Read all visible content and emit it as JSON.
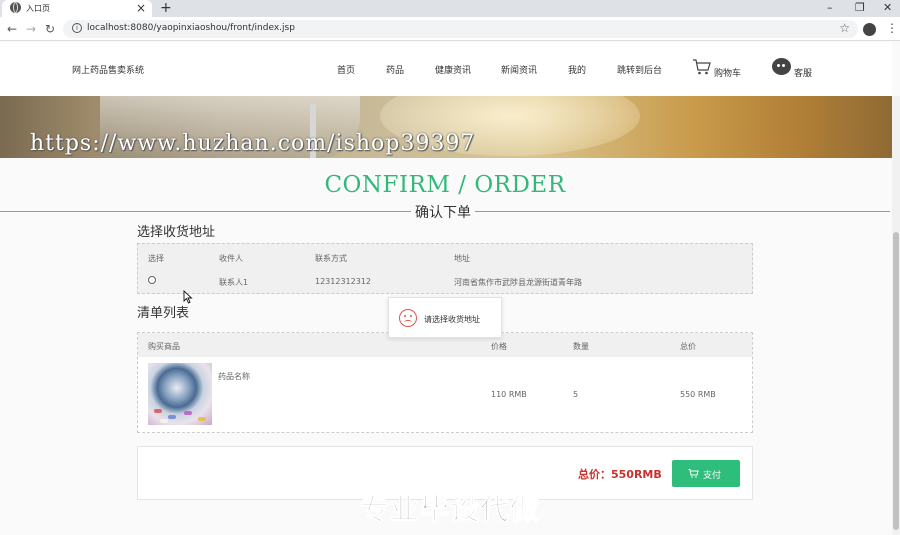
{
  "browser": {
    "tab_title": "入口页",
    "url": "localhost:8080/yaopinxiaoshou/front/index.jsp",
    "newtab_label": "+",
    "tab_close": "×",
    "minimize": "–",
    "restore": "❐",
    "close": "✕",
    "back": "←",
    "forward": "→",
    "reload": "↻",
    "star": "☆",
    "menu": "⋮",
    "info": "i"
  },
  "site": {
    "logo": "网上药品售卖系统",
    "nav": [
      "首页",
      "药品",
      "健康资讯",
      "新闻资讯",
      "我的",
      "跳转到后台"
    ],
    "cart": "购物车",
    "service": "客服"
  },
  "banner": {
    "watermark": "https://www.huzhan.com/ishop39397"
  },
  "page": {
    "title_en": "CONFIRM / ORDER",
    "title_cn": "确认下单",
    "address_section": "选择收货地址",
    "list_section": "清单列表"
  },
  "address_table": {
    "headers": [
      "选择",
      "收件人",
      "联系方式",
      "地址"
    ],
    "rows": [
      {
        "name": "联系人1",
        "phone": "12312312312",
        "address": "河南省焦作市武陟县龙源街道青年路"
      }
    ]
  },
  "list_table": {
    "headers": [
      "购买商品",
      "价格",
      "数量",
      "总价"
    ],
    "rows": [
      {
        "product": "药品名称",
        "price": "110 RMB",
        "quantity": "5",
        "total": "550 RMB"
      }
    ]
  },
  "toast": {
    "message": "请选择收货地址"
  },
  "payment": {
    "total": "总价：550RMB",
    "pay_label": "支付"
  },
  "overlay": {
    "text": "专业毕设代做"
  }
}
